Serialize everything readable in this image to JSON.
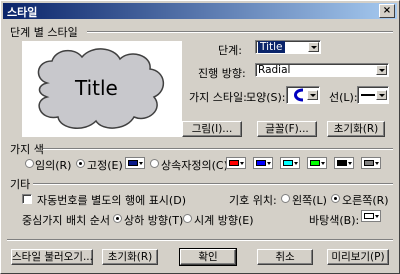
{
  "window": {
    "title": "스타일",
    "close": "×"
  },
  "style_section": {
    "label": "단계 별 스타일",
    "preview_text": "Title",
    "level_label": "단계:",
    "level_value": "Title",
    "direction_label": "진행 방향:",
    "direction_value": "Radial",
    "branch_style_label": "가지 스타일:",
    "shape_label": "모양(S):",
    "line_label": "선(L):",
    "picture_button": "그림(I)...",
    "font_button": "글꼴(F)...",
    "reset_button": "초기화(R)"
  },
  "branch_color": {
    "label": "가지 색",
    "random_label": "임의(R)",
    "fixed_label": "고정(E)",
    "relative_label": "상속자정의(C)",
    "selected": "fixed",
    "fixed_color": "#0a1a8a",
    "custom_colors": [
      "#ff0000",
      "#0000ff",
      "#00ffff",
      "#00ff00",
      "#000000",
      "#808080"
    ]
  },
  "other": {
    "label": "기타",
    "auto_number_label": "자동번호를 별도의 행에 표시(D)",
    "symbol_position_label": "기호 위치:",
    "symbol_left": "왼쪽(L)",
    "symbol_right": "오른쪽(R)",
    "symbol_selected": "right",
    "order_label": "중심가지 배치 순서",
    "order_up": "상하 방향(T)",
    "order_clock": "시계 방향(E)",
    "order_selected": "up",
    "bg_color_label": "바탕색(B):",
    "bg_color": "#ffffff"
  },
  "footer": {
    "load_style": "스타일 불러오기...",
    "reset": "초기화(R)",
    "ok": "확인",
    "cancel": "취소",
    "preview": "미리보기(P)"
  }
}
